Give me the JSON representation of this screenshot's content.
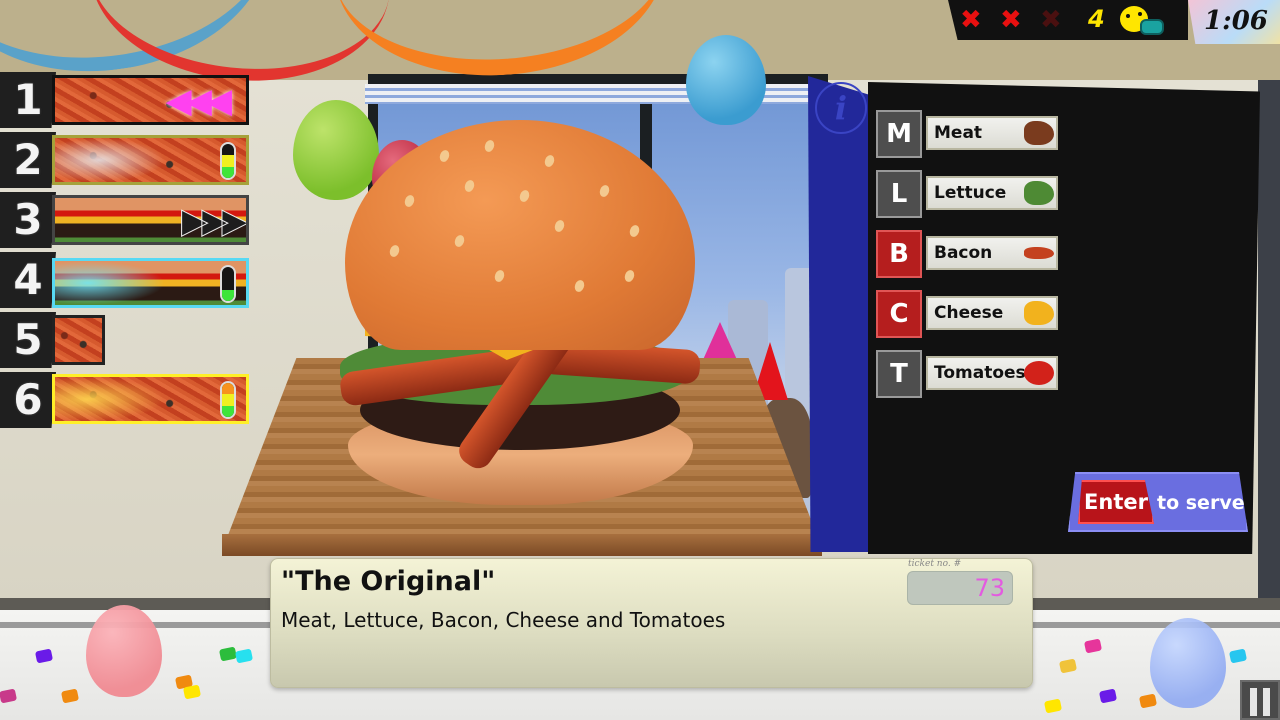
{
  "game": {
    "status": {
      "strikes_total": 3,
      "strikes_used": 2,
      "strike_icon": "x-mark-icon",
      "served_count": "4",
      "served_icon": "customer-face-icon",
      "timer": "1:06"
    },
    "order_queue": [
      {
        "slot": "1",
        "food": "pizza",
        "state": "incoming",
        "indicator": "rewind-chevrons",
        "border_color": "#111111"
      },
      {
        "slot": "2",
        "food": "pizza",
        "state": "cooking",
        "indicator": "cook-meter",
        "cook_level": 1,
        "cook_max": 3,
        "border_color": "#a6a23a"
      },
      {
        "slot": "3",
        "food": "burger",
        "state": "ready",
        "indicator": "forward-chevrons",
        "border_color": "#444444"
      },
      {
        "slot": "4",
        "food": "burger",
        "state": "cooking",
        "indicator": "cook-meter",
        "cook_level": 1,
        "cook_max": 3,
        "border_color": "#58d9f3"
      },
      {
        "slot": "5",
        "food": "pizza",
        "state": "waiting",
        "indicator": "none",
        "border_color": "#111111"
      },
      {
        "slot": "6",
        "food": "pizza",
        "state": "cooking",
        "indicator": "cook-meter",
        "cook_level": 3,
        "cook_max": 3,
        "border_color": "#ffef28"
      }
    ],
    "recipe_panel": {
      "info_icon": "info-icon",
      "ingredients": [
        {
          "key": "M",
          "label": "Meat",
          "added": false,
          "icon": "meat-icon",
          "icon_color": "#7a3b1e"
        },
        {
          "key": "L",
          "label": "Lettuce",
          "added": false,
          "icon": "lettuce-icon",
          "icon_color": "#4e8a34"
        },
        {
          "key": "B",
          "label": "Bacon",
          "added": true,
          "icon": "bacon-icon",
          "icon_color": "#c4411f"
        },
        {
          "key": "C",
          "label": "Cheese",
          "added": true,
          "icon": "cheese-icon",
          "icon_color": "#f2b21d"
        },
        {
          "key": "T",
          "label": "Tomatoes",
          "added": false,
          "icon": "tomato-icon",
          "icon_color": "#d2221a"
        }
      ],
      "serve": {
        "key": "Enter",
        "label": "to serve"
      }
    },
    "ticket": {
      "title": "\"The Original\"",
      "description": "Meat, Lettuce, Bacon, Cheese and Tomatoes",
      "number_label": "ticket no. #",
      "number": "73"
    },
    "pause_icon": "pause-icon"
  },
  "colors": {
    "strike_active": "#e91010",
    "strike_inactive": "#4a1010",
    "served_yellow": "#ffe600",
    "key_added_red": "#b51e1e",
    "key_default_gray": "#4e4e4e",
    "serve_button_blue": "#6a6ee0",
    "ticket_number_pink": "#e35be0",
    "info_strip_blue": "#22289a"
  }
}
